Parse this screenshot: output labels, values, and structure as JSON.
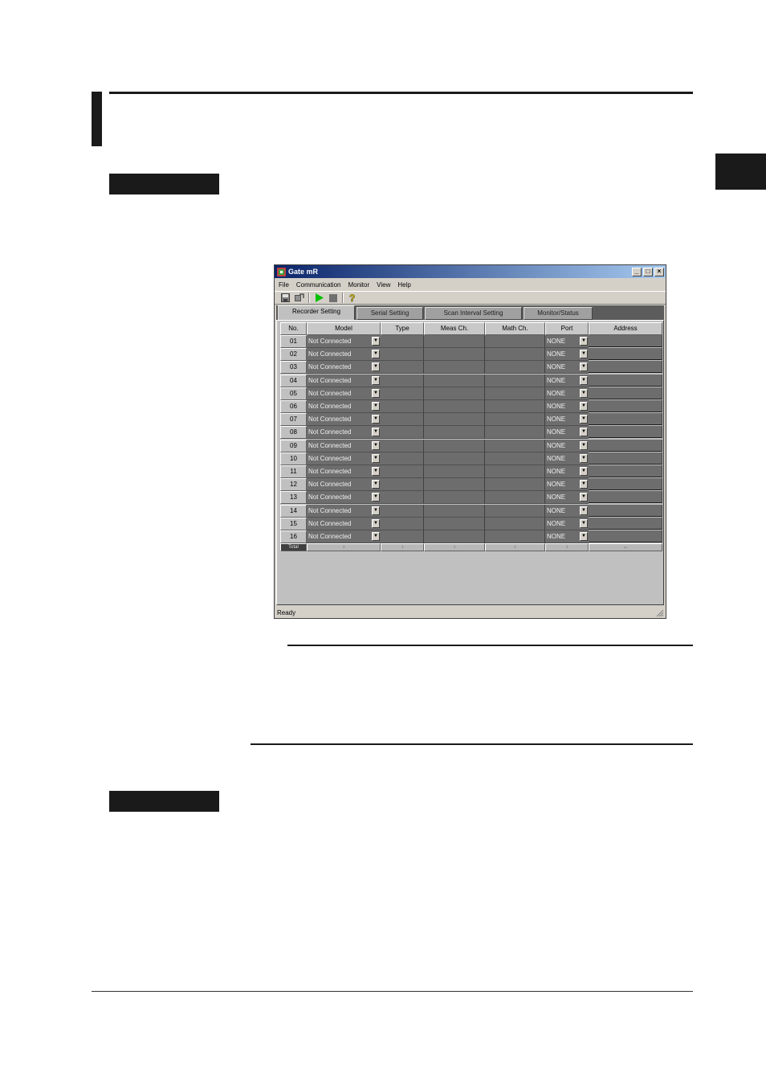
{
  "window": {
    "title": "Gate mR",
    "controls": {
      "minimize": "_",
      "maximize": "□",
      "close": "×"
    }
  },
  "menu": [
    "File",
    "Communication",
    "Monitor",
    "View",
    "Help"
  ],
  "toolbar": {
    "buttons": [
      "save-icon",
      "refresh-icon",
      "start-icon",
      "stop-icon",
      "help-icon"
    ],
    "start_color": "#00c000"
  },
  "tabs": [
    "Recorder Setting",
    "Serial Setting",
    "Scan Interval Setting",
    "Monitor/Status"
  ],
  "active_tab": "Recorder Setting",
  "table": {
    "columns": [
      "No.",
      "Model",
      "Type",
      "Meas Ch.",
      "Math Ch.",
      "Port",
      "Address"
    ],
    "rows": [
      {
        "no": "01",
        "model": "Not Connected",
        "port": "NONE"
      },
      {
        "no": "02",
        "model": "Not Connected",
        "port": "NONE"
      },
      {
        "no": "03",
        "model": "Not Connected",
        "port": "NONE"
      },
      {
        "no": "04",
        "model": "Not Connected",
        "port": "NONE"
      },
      {
        "no": "05",
        "model": "Not Connected",
        "port": "NONE"
      },
      {
        "no": "06",
        "model": "Not Connected",
        "port": "NONE"
      },
      {
        "no": "07",
        "model": "Not Connected",
        "port": "NONE"
      },
      {
        "no": "08",
        "model": "Not Connected",
        "port": "NONE"
      },
      {
        "no": "09",
        "model": "Not Connected",
        "port": "NONE"
      },
      {
        "no": "10",
        "model": "Not Connected",
        "port": "NONE"
      },
      {
        "no": "11",
        "model": "Not Connected",
        "port": "NONE"
      },
      {
        "no": "12",
        "model": "Not Connected",
        "port": "NONE"
      },
      {
        "no": "13",
        "model": "Not Connected",
        "port": "NONE"
      },
      {
        "no": "14",
        "model": "Not Connected",
        "port": "NONE"
      },
      {
        "no": "15",
        "model": "Not Connected",
        "port": "NONE"
      },
      {
        "no": "16",
        "model": "Not Connected",
        "port": "NONE"
      }
    ],
    "footer": [
      "Total",
      "↕",
      "↕",
      "↕",
      "↕",
      "↕",
      "↔"
    ]
  },
  "status": "Ready"
}
